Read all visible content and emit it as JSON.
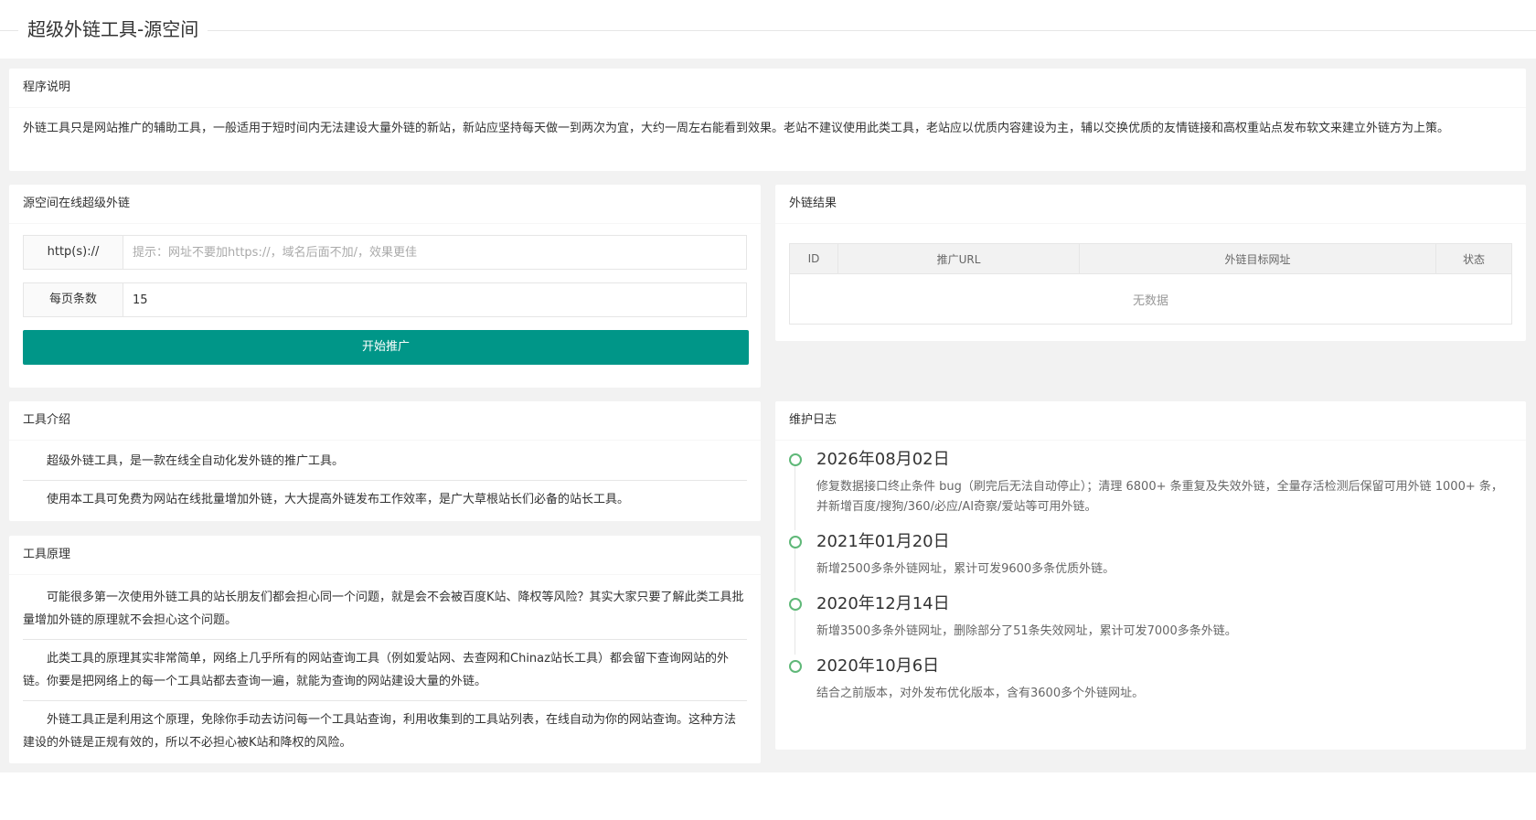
{
  "page_title": "超级外链工具-源空间",
  "program_desc": {
    "title": "程序说明",
    "text": "外链工具只是网站推广的辅助工具，一般适用于短时间内无法建设大量外链的新站，新站应坚持每天做一到两次为宜，大约一周左右能看到效果。老站不建议使用此类工具，老站应以优质内容建设为主，辅以交换优质的友情链接和高权重站点发布软文来建立外链方为上策。"
  },
  "online_tool": {
    "title": "源空间在线超级外链",
    "url_label": "http(s)://",
    "url_placeholder": "提示：网址不要加https://，域名后面不加/，效果更佳",
    "per_page_label": "每页条数",
    "per_page_value": "15",
    "start_button": "开始推广"
  },
  "results": {
    "title": "外链结果",
    "columns": [
      "ID",
      "推广URL",
      "外链目标网址",
      "状态"
    ],
    "empty_text": "无数据"
  },
  "tool_intro": {
    "title": "工具介绍",
    "paragraphs": [
      "超级外链工具，是一款在线全自动化发外链的推广工具。",
      "使用本工具可免费为网站在线批量增加外链，大大提高外链发布工作效率，是广大草根站长们必备的站长工具。"
    ]
  },
  "tool_principle": {
    "title": "工具原理",
    "paragraphs": [
      "可能很多第一次使用外链工具的站长朋友们都会担心同一个问题，就是会不会被百度K站、降权等风险？其实大家只要了解此类工具批量增加外链的原理就不会担心这个问题。",
      "此类工具的原理其实非常简单，网络上几乎所有的网站查询工具（例如爱站网、去查网和Chinaz站长工具）都会留下查询网站的外链。你要是把网络上的每一个工具站都去查询一遍，就能为查询的网站建设大量的外链。",
      "外链工具正是利用这个原理，免除你手动去访问每一个工具站查询，利用收集到的工具站列表，在线自动为你的网站查询。这种方法建设的外链是正规有效的，所以不必担心被K站和降权的风险。"
    ]
  },
  "changelog": {
    "title": "维护日志",
    "entries": [
      {
        "date": "2026年08月02日",
        "text": "修复数据接口终止条件 bug（刷完后无法自动停止）；清理 6800+ 条重复及失效外链，全量存活检测后保留可用外链 1000+ 条，并新增百度/搜狗/360/必应/AI奇察/爱站等可用外链。"
      },
      {
        "date": "2021年01月20日",
        "text": "新增2500多条外链网址，累计可发9600多条优质外链。"
      },
      {
        "date": "2020年12月14日",
        "text": "新增3500多条外链网址，删除部分了51条失效网址，累计可发7000多条外链。"
      },
      {
        "date": "2020年10月6日",
        "text": "结合之前版本，对外发布优化版本，含有3600多个外链网址。"
      }
    ]
  },
  "colors": {
    "accent": "#009688",
    "timeline_dot": "#5FB878",
    "page_bg": "#f2f2f2"
  }
}
